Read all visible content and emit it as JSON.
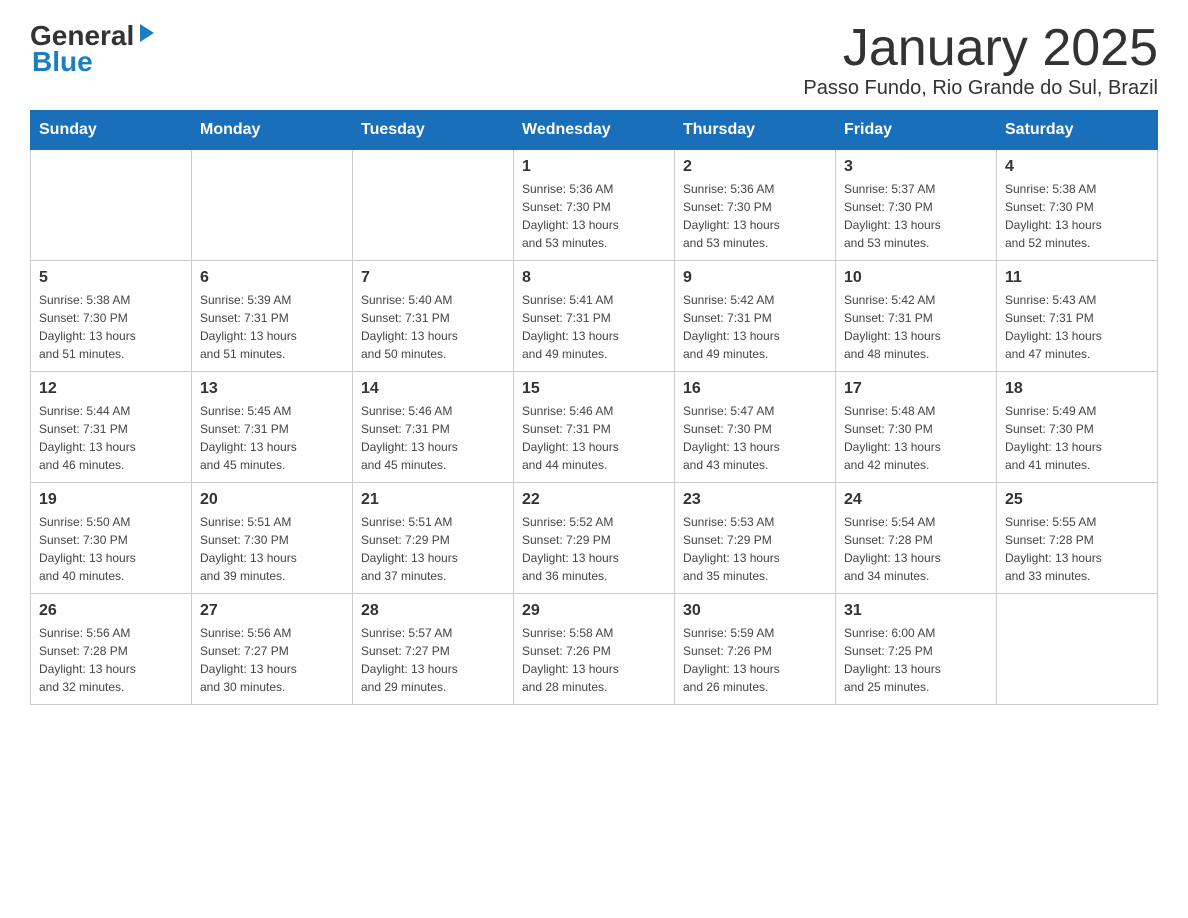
{
  "logo": {
    "line1": "General",
    "line2": "Blue",
    "triangle": "▶"
  },
  "title": "January 2025",
  "subtitle": "Passo Fundo, Rio Grande do Sul, Brazil",
  "days_of_week": [
    "Sunday",
    "Monday",
    "Tuesday",
    "Wednesday",
    "Thursday",
    "Friday",
    "Saturday"
  ],
  "weeks": [
    [
      {
        "day": "",
        "info": ""
      },
      {
        "day": "",
        "info": ""
      },
      {
        "day": "",
        "info": ""
      },
      {
        "day": "1",
        "info": "Sunrise: 5:36 AM\nSunset: 7:30 PM\nDaylight: 13 hours\nand 53 minutes."
      },
      {
        "day": "2",
        "info": "Sunrise: 5:36 AM\nSunset: 7:30 PM\nDaylight: 13 hours\nand 53 minutes."
      },
      {
        "day": "3",
        "info": "Sunrise: 5:37 AM\nSunset: 7:30 PM\nDaylight: 13 hours\nand 53 minutes."
      },
      {
        "day": "4",
        "info": "Sunrise: 5:38 AM\nSunset: 7:30 PM\nDaylight: 13 hours\nand 52 minutes."
      }
    ],
    [
      {
        "day": "5",
        "info": "Sunrise: 5:38 AM\nSunset: 7:30 PM\nDaylight: 13 hours\nand 51 minutes."
      },
      {
        "day": "6",
        "info": "Sunrise: 5:39 AM\nSunset: 7:31 PM\nDaylight: 13 hours\nand 51 minutes."
      },
      {
        "day": "7",
        "info": "Sunrise: 5:40 AM\nSunset: 7:31 PM\nDaylight: 13 hours\nand 50 minutes."
      },
      {
        "day": "8",
        "info": "Sunrise: 5:41 AM\nSunset: 7:31 PM\nDaylight: 13 hours\nand 49 minutes."
      },
      {
        "day": "9",
        "info": "Sunrise: 5:42 AM\nSunset: 7:31 PM\nDaylight: 13 hours\nand 49 minutes."
      },
      {
        "day": "10",
        "info": "Sunrise: 5:42 AM\nSunset: 7:31 PM\nDaylight: 13 hours\nand 48 minutes."
      },
      {
        "day": "11",
        "info": "Sunrise: 5:43 AM\nSunset: 7:31 PM\nDaylight: 13 hours\nand 47 minutes."
      }
    ],
    [
      {
        "day": "12",
        "info": "Sunrise: 5:44 AM\nSunset: 7:31 PM\nDaylight: 13 hours\nand 46 minutes."
      },
      {
        "day": "13",
        "info": "Sunrise: 5:45 AM\nSunset: 7:31 PM\nDaylight: 13 hours\nand 45 minutes."
      },
      {
        "day": "14",
        "info": "Sunrise: 5:46 AM\nSunset: 7:31 PM\nDaylight: 13 hours\nand 45 minutes."
      },
      {
        "day": "15",
        "info": "Sunrise: 5:46 AM\nSunset: 7:31 PM\nDaylight: 13 hours\nand 44 minutes."
      },
      {
        "day": "16",
        "info": "Sunrise: 5:47 AM\nSunset: 7:30 PM\nDaylight: 13 hours\nand 43 minutes."
      },
      {
        "day": "17",
        "info": "Sunrise: 5:48 AM\nSunset: 7:30 PM\nDaylight: 13 hours\nand 42 minutes."
      },
      {
        "day": "18",
        "info": "Sunrise: 5:49 AM\nSunset: 7:30 PM\nDaylight: 13 hours\nand 41 minutes."
      }
    ],
    [
      {
        "day": "19",
        "info": "Sunrise: 5:50 AM\nSunset: 7:30 PM\nDaylight: 13 hours\nand 40 minutes."
      },
      {
        "day": "20",
        "info": "Sunrise: 5:51 AM\nSunset: 7:30 PM\nDaylight: 13 hours\nand 39 minutes."
      },
      {
        "day": "21",
        "info": "Sunrise: 5:51 AM\nSunset: 7:29 PM\nDaylight: 13 hours\nand 37 minutes."
      },
      {
        "day": "22",
        "info": "Sunrise: 5:52 AM\nSunset: 7:29 PM\nDaylight: 13 hours\nand 36 minutes."
      },
      {
        "day": "23",
        "info": "Sunrise: 5:53 AM\nSunset: 7:29 PM\nDaylight: 13 hours\nand 35 minutes."
      },
      {
        "day": "24",
        "info": "Sunrise: 5:54 AM\nSunset: 7:28 PM\nDaylight: 13 hours\nand 34 minutes."
      },
      {
        "day": "25",
        "info": "Sunrise: 5:55 AM\nSunset: 7:28 PM\nDaylight: 13 hours\nand 33 minutes."
      }
    ],
    [
      {
        "day": "26",
        "info": "Sunrise: 5:56 AM\nSunset: 7:28 PM\nDaylight: 13 hours\nand 32 minutes."
      },
      {
        "day": "27",
        "info": "Sunrise: 5:56 AM\nSunset: 7:27 PM\nDaylight: 13 hours\nand 30 minutes."
      },
      {
        "day": "28",
        "info": "Sunrise: 5:57 AM\nSunset: 7:27 PM\nDaylight: 13 hours\nand 29 minutes."
      },
      {
        "day": "29",
        "info": "Sunrise: 5:58 AM\nSunset: 7:26 PM\nDaylight: 13 hours\nand 28 minutes."
      },
      {
        "day": "30",
        "info": "Sunrise: 5:59 AM\nSunset: 7:26 PM\nDaylight: 13 hours\nand 26 minutes."
      },
      {
        "day": "31",
        "info": "Sunrise: 6:00 AM\nSunset: 7:25 PM\nDaylight: 13 hours\nand 25 minutes."
      },
      {
        "day": "",
        "info": ""
      }
    ]
  ]
}
